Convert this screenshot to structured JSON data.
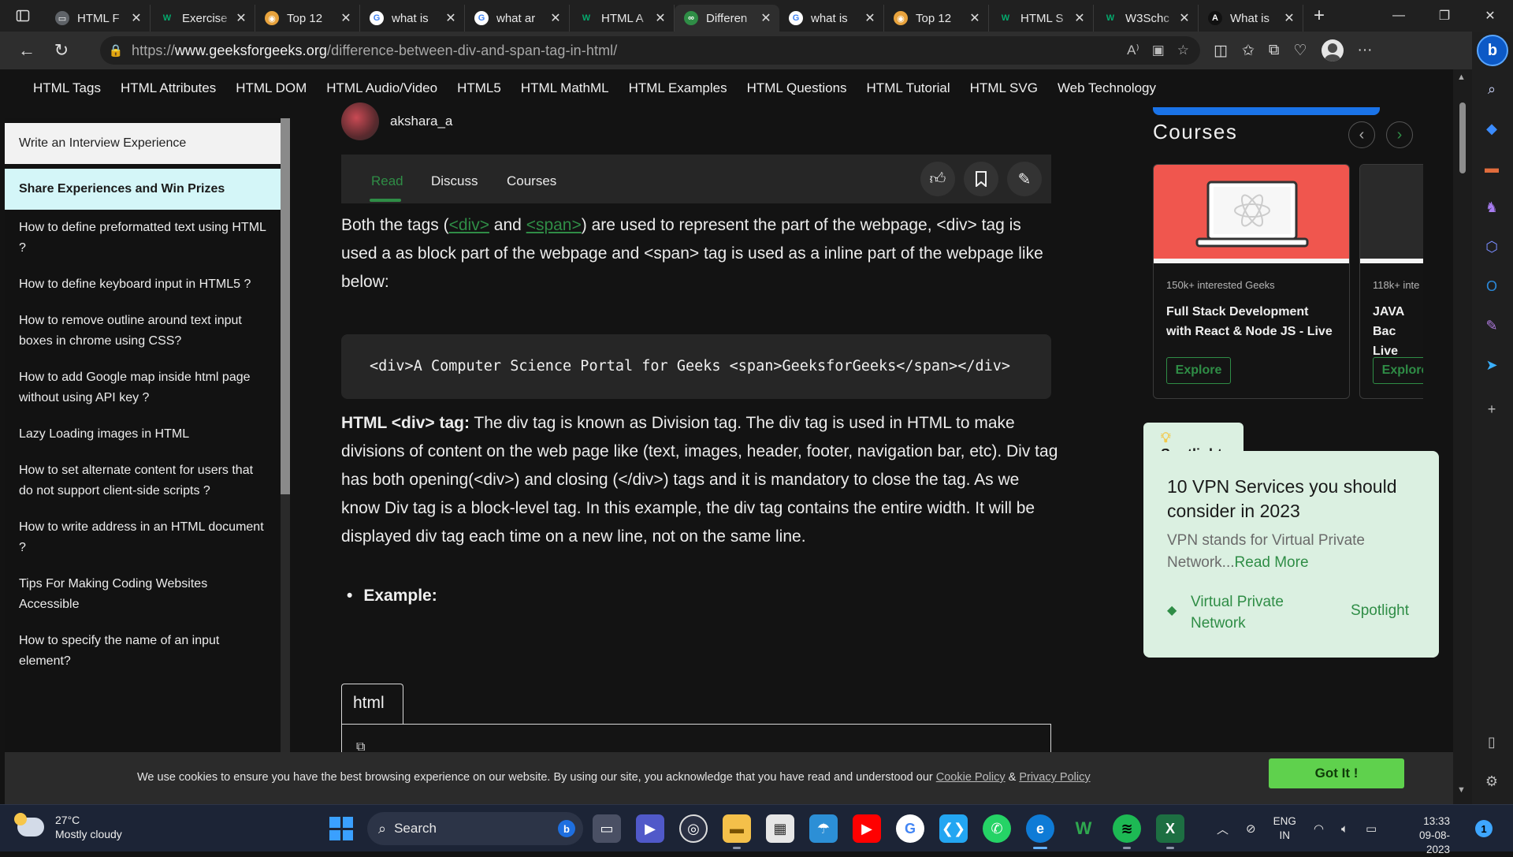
{
  "browser": {
    "tabs": [
      {
        "title": "HTML F",
        "icon": "doc-icon"
      },
      {
        "title": "Exercise",
        "icon": "w3schools-icon"
      },
      {
        "title": "Top 12",
        "icon": "chrome-icon"
      },
      {
        "title": "what is",
        "icon": "google-icon"
      },
      {
        "title": "what ar",
        "icon": "google-icon"
      },
      {
        "title": "HTML A",
        "icon": "w3schools-icon"
      },
      {
        "title": "Differen",
        "icon": "gfg-icon",
        "active": true
      },
      {
        "title": "what is",
        "icon": "google-icon"
      },
      {
        "title": "Top 12",
        "icon": "chrome-icon"
      },
      {
        "title": "HTML S",
        "icon": "w3schools-icon"
      },
      {
        "title": "W3Schc",
        "icon": "w3schools-icon"
      },
      {
        "title": "What is",
        "icon": "ai-icon"
      }
    ],
    "url_prefix": "https://",
    "url_domain": "www.geeksforgeeks.org",
    "url_path": "/difference-between-div-and-span-tag-in-html/"
  },
  "site_nav": [
    "HTML Tags",
    "HTML Attributes",
    "HTML DOM",
    "HTML Audio/Video",
    "HTML5",
    "HTML MathML",
    "HTML Examples",
    "HTML Questions",
    "HTML Tutorial",
    "HTML SVG",
    "Web Technology"
  ],
  "sidebar": {
    "button_interview": "Write an Interview Experience",
    "button_share": "Share Experiences and Win Prizes",
    "links": [
      "How to define preformatted text using HTML ?",
      "How to define keyboard input in HTML5 ?",
      "How to remove outline around text input boxes in chrome using CSS?",
      "How to add Google map inside html page without using API key ?",
      "Lazy Loading images in HTML",
      "How to set alternate content for users that do not support client-side scripts ?",
      "How to write address in an HTML document ?",
      "Tips For Making Coding Websites Accessible",
      "How to specify the name of an input element?"
    ]
  },
  "article": {
    "author": "akshara_a",
    "tabs": {
      "read": "Read",
      "discuss": "Discuss",
      "courses": "Courses"
    },
    "para1_a": "Both the tags (",
    "link_div": "<div>",
    "para1_b": " and ",
    "link_span": "<span>",
    "para1_c": ") are used to represent the part of the webpage, <div> tag is used a as block part of the webpage and <span> tag is used as a inline part of the webpage like below:",
    "code_line": "<div>A Computer Science Portal for Geeks <span>GeeksforGeeks</span></div>",
    "para2_bold": "HTML <div> tag:",
    "para2": " The div tag is known as Division tag. The div tag is used in HTML to make divisions of content on the web page like (text, images, header, footer, navigation bar, etc). Div tag has both opening(<div>) and closing (</div>) tags and it is mandatory to close the tag. As we know Div tag is a block-level tag. In this example, the div tag contains the entire width. It will be displayed div tag each time on a new line, not on the same line.",
    "bullet": "Example:",
    "code_tab": "html"
  },
  "courses": {
    "heading": "Courses",
    "cards": [
      {
        "interest": "150k+ interested Geeks",
        "name": "Full Stack Development with React & Node JS - Live",
        "button": "Explore"
      },
      {
        "interest": "118k+ inte",
        "name": "JAVA Bac Live",
        "button": "Explore"
      }
    ]
  },
  "spotlight": {
    "tab": "Spotlight",
    "title": "10 VPN Services you should consider in 2023",
    "desc": "VPN stands for Virtual Private Network...",
    "read_more": "Read More",
    "tag": "Virtual Private Network",
    "label": "Spotlight"
  },
  "cookie": {
    "message": "We use cookies to ensure you have the best browsing experience on our website. By using our site, you acknowledge that you have read and understood our ",
    "cookie_policy": "Cookie Policy",
    "amp": " & ",
    "privacy_policy": "Privacy Policy",
    "button": "Got It !"
  },
  "taskbar": {
    "temp": "27°C",
    "weather": "Mostly cloudy",
    "search": "Search",
    "lang1": "ENG",
    "lang2": "IN",
    "time": "13:33",
    "date": "09-08-2023",
    "notifications": "1"
  },
  "colors": {
    "gfg_green": "#2f8d46",
    "accent_blue": "#1a73e8"
  }
}
